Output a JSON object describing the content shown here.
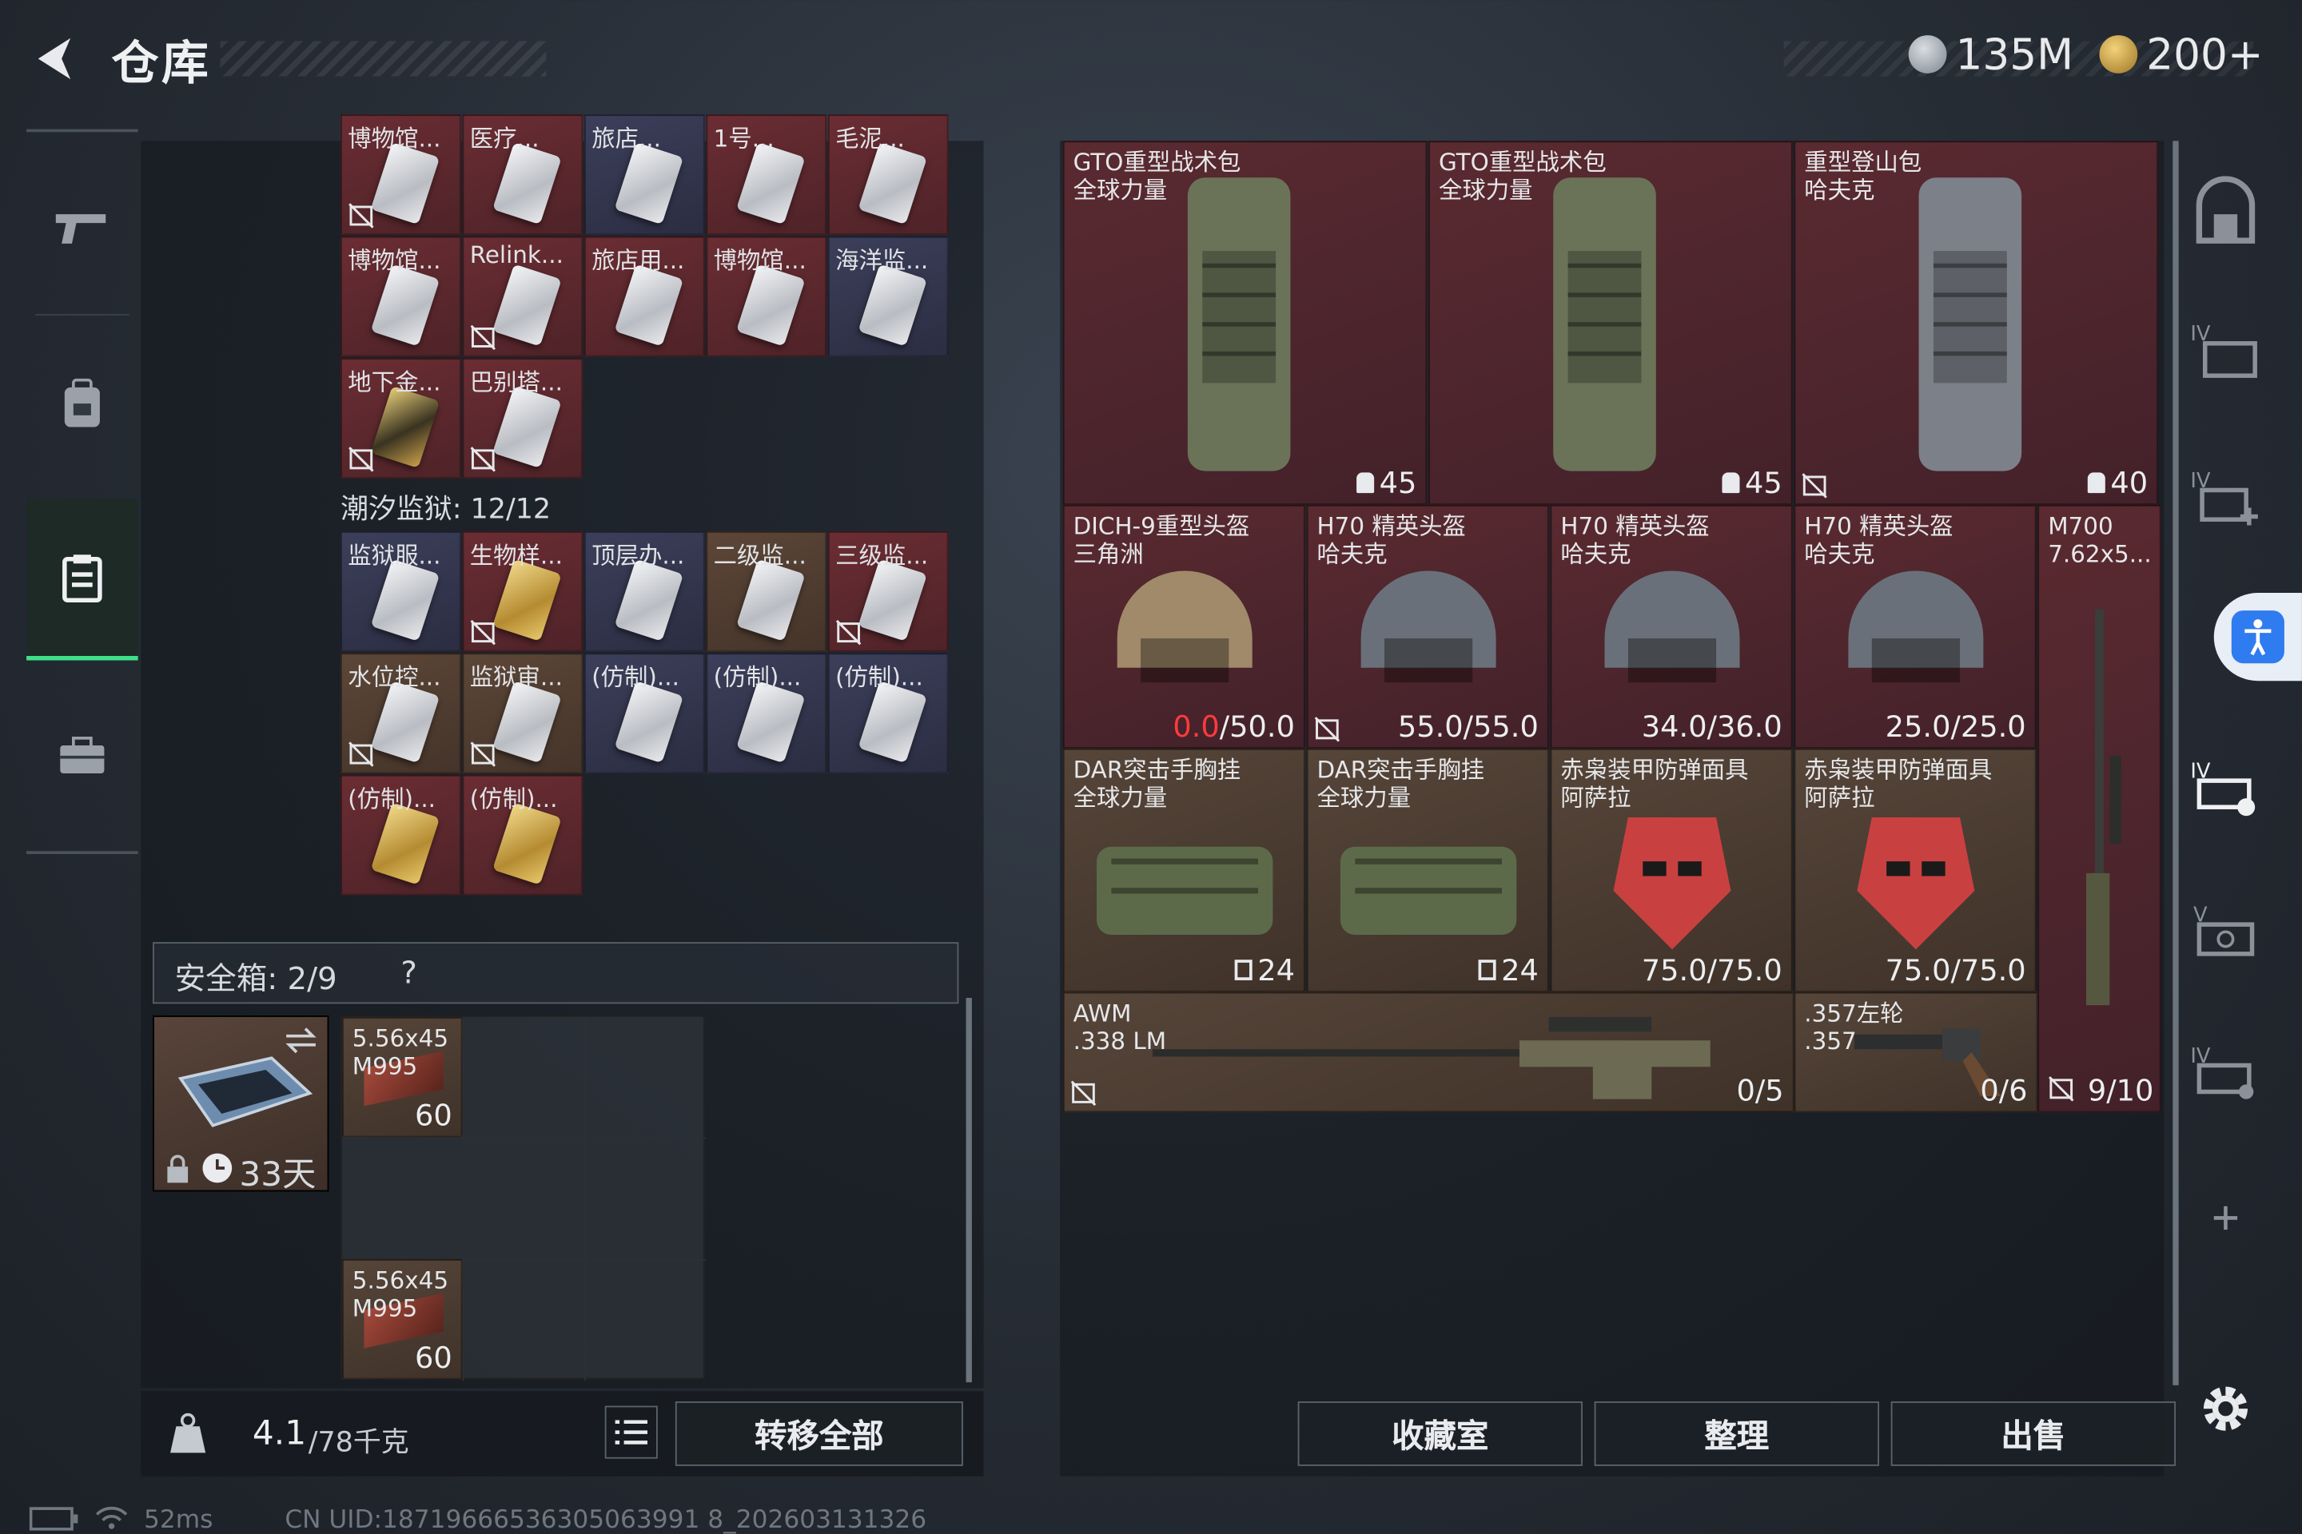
{
  "header": {
    "title": "仓库",
    "currency1": "135M",
    "currency2": "200+"
  },
  "nav": {
    "items": [
      "weapons",
      "backpack",
      "storage",
      "briefcase"
    ]
  },
  "storage": {
    "top_cards": [
      {
        "label": "博物馆...",
        "color": "red",
        "card": "white",
        "flag": true
      },
      {
        "label": "医疗...",
        "color": "red",
        "card": "white",
        "flag": false
      },
      {
        "label": "旅店...",
        "color": "blue",
        "card": "white",
        "flag": false
      },
      {
        "label": "1号...",
        "color": "red",
        "card": "white",
        "flag": false
      },
      {
        "label": "毛泥...",
        "color": "red",
        "card": "white",
        "flag": false
      },
      {
        "label": "博物馆...",
        "color": "red",
        "card": "white",
        "flag": false
      },
      {
        "label": "Relink...",
        "color": "red",
        "card": "white",
        "flag": true
      },
      {
        "label": "旅店用...",
        "color": "red",
        "card": "white",
        "flag": false
      },
      {
        "label": "博物馆...",
        "color": "red",
        "card": "white",
        "flag": false
      },
      {
        "label": "海洋监...",
        "color": "blue",
        "card": "white",
        "flag": false
      },
      {
        "label": "地下金...",
        "color": "red",
        "card": "dark",
        "flag": true
      },
      {
        "label": "巴别塔...",
        "color": "red",
        "card": "white",
        "flag": true
      }
    ],
    "prison_title": "潮汐监狱: 12/12",
    "prison_cards": [
      {
        "label": "监狱服...",
        "color": "blue",
        "card": "white",
        "flag": false
      },
      {
        "label": "生物样...",
        "color": "red",
        "card": "gold",
        "flag": true
      },
      {
        "label": "顶层办...",
        "color": "blue",
        "card": "white",
        "flag": false
      },
      {
        "label": "二级监...",
        "color": "brown",
        "card": "white",
        "flag": false
      },
      {
        "label": "三级监...",
        "color": "red",
        "card": "white",
        "flag": true
      },
      {
        "label": "水位控...",
        "color": "brown",
        "card": "white",
        "flag": true
      },
      {
        "label": "监狱审...",
        "color": "brown",
        "card": "white",
        "flag": true
      },
      {
        "label": "(仿制)...",
        "color": "blue",
        "card": "white",
        "flag": false
      },
      {
        "label": "(仿制)...",
        "color": "blue",
        "card": "white",
        "flag": false
      },
      {
        "label": "(仿制)...",
        "color": "blue",
        "card": "white",
        "flag": false
      },
      {
        "label": "(仿制)...",
        "color": "red",
        "card": "gold",
        "flag": false
      },
      {
        "label": "(仿制)...",
        "color": "red",
        "card": "gold",
        "flag": false
      }
    ]
  },
  "safebox": {
    "title": "安全箱: 2/9",
    "help": "?",
    "timer": "33天",
    "ammo": [
      {
        "name": "5.56x45\nM995",
        "count": "60"
      },
      {
        "name": "5.56x45\nM995",
        "count": "60"
      }
    ]
  },
  "footer_left": {
    "weight": "4.1",
    "weight_max": "/78千克",
    "transfer": "转移全部"
  },
  "inventory": {
    "backpacks": [
      {
        "label": "GTO重型战术包\n全球力量",
        "value": "45"
      },
      {
        "label": "GTO重型战术包\n全球力量",
        "value": "45"
      },
      {
        "label": "重型登山包\n哈夫克",
        "value": "40"
      }
    ],
    "helmets": [
      {
        "label": "DICH-9重型头盔\n三角洲",
        "cur": "0.0",
        "max": "/50.0"
      },
      {
        "label": "H70 精英头盔\n哈夫克",
        "cur": "55.0",
        "max": "/55.0"
      },
      {
        "label": "H70 精英头盔\n哈夫克",
        "cur": "34.0",
        "max": "/36.0"
      },
      {
        "label": "H70 精英头盔\n哈夫克",
        "cur": "25.0",
        "max": "/25.0"
      }
    ],
    "rigs": [
      {
        "label": "DAR突击手胸挂\n全球力量",
        "value": "24"
      },
      {
        "label": "DAR突击手胸挂\n全球力量",
        "value": "24"
      },
      {
        "label": "赤枭装甲防弹面具\n阿萨拉",
        "value": "75.0/75.0"
      },
      {
        "label": "赤枭装甲防弹面具\n阿萨拉",
        "value": "75.0/75.0"
      }
    ],
    "m700": {
      "label": "M700\n7.62x5...",
      "value": "9/10"
    },
    "awm": {
      "label": "AWM\n.338 LM",
      "value": "0/5"
    },
    "revolver": {
      "label": ".357左轮\n.357",
      "value": "0/6"
    }
  },
  "footer_right": {
    "collection": "收藏室",
    "sort": "整理",
    "sell": "出售"
  },
  "status": {
    "ping": "52ms",
    "uid": "CN UID:18719666536305063991 8_202603131326"
  },
  "colors": {
    "accent": "#3ee08a",
    "red_cell": "#5a2a30",
    "blue_cell": "#3c3f5a",
    "brown_cell": "#564539"
  }
}
